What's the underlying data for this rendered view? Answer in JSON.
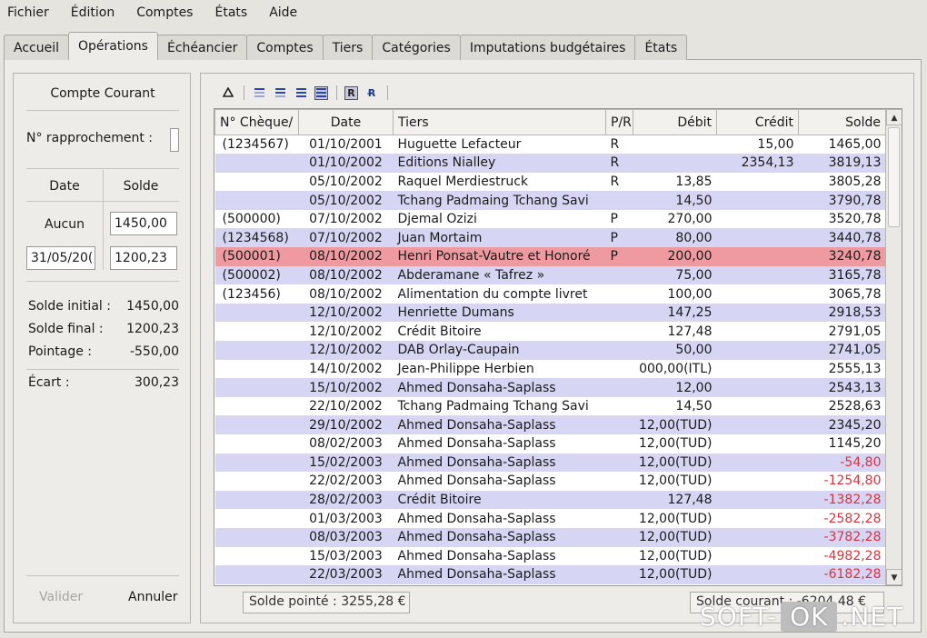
{
  "menu": [
    "Fichier",
    "Édition",
    "Comptes",
    "États",
    "Aide"
  ],
  "tabs": [
    "Accueil",
    "Opérations",
    "Échéancier",
    "Comptes",
    "Tiers",
    "Catégories",
    "Imputations budgétaires",
    "États"
  ],
  "active_tab": "Opérations",
  "reconcile": {
    "account": "Compte Courant",
    "rapprochement_label": "N° rapprochement :",
    "col_date": "Date",
    "col_solde": "Solde",
    "aucun": "Aucun",
    "start_solde": "1450,00",
    "end_date": "31/05/20(",
    "end_solde": "1200,23",
    "solde_initial_label": "Solde initial :",
    "solde_initial": "1450,00",
    "solde_final_label": "Solde final :",
    "solde_final": "1200,23",
    "pointage_label": "Pointage :",
    "pointage": "-550,00",
    "ecart_label": "Écart :",
    "ecart": "300,23",
    "valider": "Valider",
    "annuler": "Annuler"
  },
  "toolbar_icons": [
    "triangle-icon",
    "one-line-icon",
    "two-lines-icon",
    "three-lines-icon",
    "four-lines-icon",
    "reconciled-r-icon",
    "unreconciled-r-icon"
  ],
  "table": {
    "headers": [
      "N° Chèque/",
      "Date",
      "Tiers",
      "P/R",
      "Débit",
      "Crédit",
      "Solde"
    ],
    "rows": [
      [
        "(1234567)",
        "01/10/2001",
        "Huguette Lefacteur",
        "R",
        "",
        "15,00",
        "1465,00"
      ],
      [
        "",
        "01/10/2002",
        "Editions Nialley",
        "R",
        "",
        "2354,13",
        "3819,13"
      ],
      [
        "",
        "05/10/2002",
        "Raquel Merdiestruck",
        "R",
        "13,85",
        "",
        "3805,28"
      ],
      [
        "",
        "05/10/2002",
        "Tchang Padmaing Tchang Savi",
        "",
        "14,50",
        "",
        "3790,78"
      ],
      [
        "(500000)",
        "07/10/2002",
        "Djemal Ozizi",
        "P",
        "270,00",
        "",
        "3520,78"
      ],
      [
        "(1234568)",
        "07/10/2002",
        "Juan Mortaim",
        "P",
        "80,00",
        "",
        "3440,78"
      ],
      [
        "(500001)",
        "08/10/2002",
        "Henri Ponsat-Vautre et Honoré",
        "P",
        "200,00",
        "",
        "3240,78"
      ],
      [
        "(500002)",
        "08/10/2002",
        "Abderamane « Tafrez »",
        "",
        "75,00",
        "",
        "3165,78"
      ],
      [
        "(123456)",
        "08/10/2002",
        "Alimentation du compte livret",
        "",
        "100,00",
        "",
        "3065,78"
      ],
      [
        "",
        "12/10/2002",
        "Henriette Dumans",
        "",
        "147,25",
        "",
        "2918,53"
      ],
      [
        "",
        "12/10/2002",
        "Crédit Bitoire",
        "",
        "127,48",
        "",
        "2791,05"
      ],
      [
        "",
        "12/10/2002",
        "DAB Orlay-Caupain",
        "",
        "50,00",
        "",
        "2741,05"
      ],
      [
        "",
        "14/10/2002",
        "Jean-Philippe Herbien",
        "",
        "000,00(ITL)",
        "",
        "2555,13"
      ],
      [
        "",
        "15/10/2002",
        "Ahmed Donsaha-Saplass",
        "",
        "12,00",
        "",
        "2543,13"
      ],
      [
        "",
        "22/10/2002",
        "Tchang Padmaing Tchang Savi",
        "",
        "14,50",
        "",
        "2528,63"
      ],
      [
        "",
        "29/10/2002",
        "Ahmed Donsaha-Saplass",
        "",
        "12,00(TUD)",
        "",
        "2345,20"
      ],
      [
        "",
        "08/02/2003",
        "Ahmed Donsaha-Saplass",
        "",
        "12,00(TUD)",
        "",
        "1145,20"
      ],
      [
        "",
        "15/02/2003",
        "Ahmed Donsaha-Saplass",
        "",
        "12,00(TUD)",
        "",
        "-54,80"
      ],
      [
        "",
        "22/02/2003",
        "Ahmed Donsaha-Saplass",
        "",
        "12,00(TUD)",
        "",
        "-1254,80"
      ],
      [
        "",
        "28/02/2003",
        "Crédit Bitoire",
        "",
        "127,48",
        "",
        "-1382,28"
      ],
      [
        "",
        "01/03/2003",
        "Ahmed Donsaha-Saplass",
        "",
        "12,00(TUD)",
        "",
        "-2582,28"
      ],
      [
        "",
        "08/03/2003",
        "Ahmed Donsaha-Saplass",
        "",
        "12,00(TUD)",
        "",
        "-3782,28"
      ],
      [
        "",
        "15/03/2003",
        "Ahmed Donsaha-Saplass",
        "",
        "12,00(TUD)",
        "",
        "-4982,28"
      ],
      [
        "",
        "22/03/2003",
        "Ahmed Donsaha-Saplass",
        "",
        "12,00(TUD)",
        "",
        "-6182,28"
      ]
    ],
    "selected_row_index": 6
  },
  "footer": {
    "solde_pointe": "Solde pointé : 3255,28 €",
    "solde_courant": "Solde courant : -6204,48 €"
  },
  "watermark": {
    "left": "SOFT-",
    "ok": "OK",
    "right": ".NET"
  },
  "colors": {
    "row_alt": "#d6d6f4",
    "row_selected": "#ef9aa0",
    "negative": "#d8323d"
  }
}
